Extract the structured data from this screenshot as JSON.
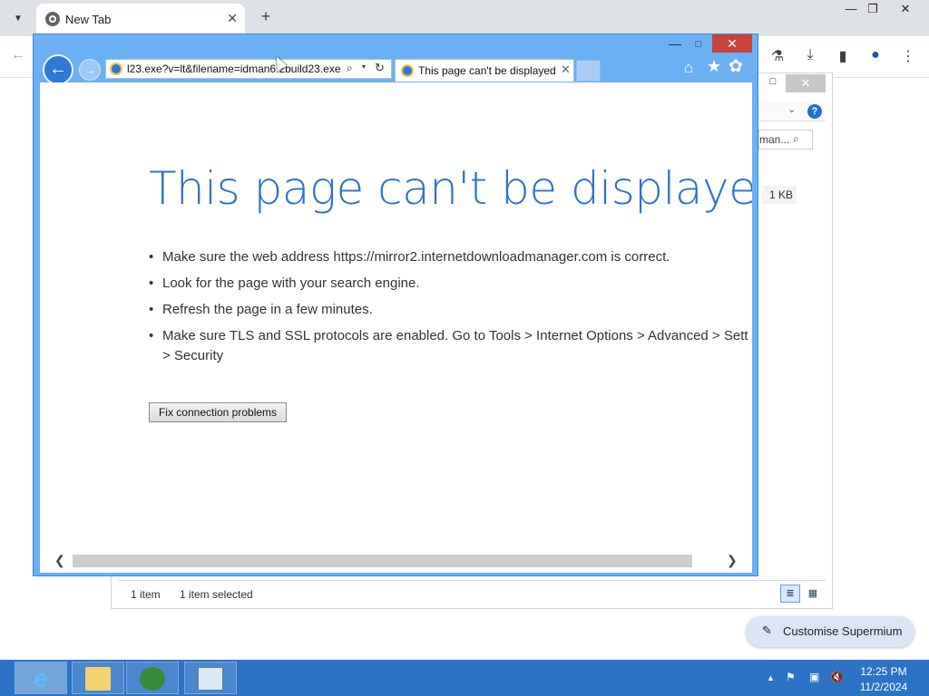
{
  "chrome": {
    "tab_title": "New Tab",
    "tab_close": "✕",
    "new_tab": "+",
    "window": {
      "minimize": "—",
      "restore": "❐",
      "close": "✕"
    },
    "toolbar": {
      "back": "←",
      "labs": "⚗",
      "download": "⤓",
      "sidepanel": "▮",
      "profile": "●",
      "menu": "⋮"
    },
    "customise_label": "Customise Supermium",
    "customise_icon": "✎"
  },
  "explorer": {
    "maximize": "□",
    "close": "✕",
    "chevron": "⌄",
    "help": "?",
    "search_text": "man...",
    "search_icon": "⌕",
    "file_size": "1 KB",
    "status_count": "1 item",
    "status_selected": "1 item selected",
    "view_details": "≣",
    "view_large": "▦"
  },
  "ie": {
    "address": "l23.exe?v=lt&filename=idman6.2build23.exe",
    "tab_title": "This page can't be displayed",
    "tab_close": "✕",
    "window": {
      "minimize": "—",
      "maximize": "□",
      "close": "✕"
    },
    "nav": {
      "back": "←",
      "forward": "→",
      "search": "⌕",
      "dropdown": "▾",
      "refresh": "↻"
    },
    "tools": {
      "home": "⌂",
      "favorites": "★",
      "settings": "✿"
    },
    "error": {
      "title": "This page can't be displayed",
      "items": [
        "Make sure the web address https://mirror2.internetdownloadmanager.com is correct.",
        "Look for the page with your search engine.",
        "Refresh the page in a few minutes.",
        "Make sure TLS and SSL protocols are enabled. Go to Tools > Internet Options > Advanced > Sett",
        "> Security"
      ],
      "bullet": "•",
      "fix_button": "Fix connection problems"
    },
    "scroll": {
      "left": "❮",
      "right": "❯"
    }
  },
  "taskbar": {
    "apps": [
      {
        "name": "internet-explorer",
        "glyph": "e"
      },
      {
        "name": "file-explorer",
        "glyph": ""
      },
      {
        "name": "browser-globe",
        "glyph": ""
      },
      {
        "name": "network-tool",
        "glyph": ""
      }
    ],
    "tray": {
      "up": "▲",
      "flag": "⚑",
      "network": "▣",
      "volume": "🔇"
    },
    "time": "12:25 PM",
    "date": "11/2/2024"
  }
}
